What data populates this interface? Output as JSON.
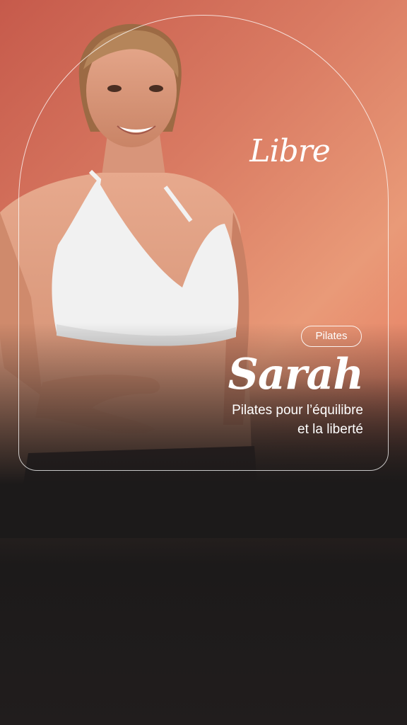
{
  "brand": {
    "word": "Libre"
  },
  "card": {
    "tag": "Pilates",
    "coach_name": "Sarah",
    "title_line1": "Pilates pour l’équilibre",
    "title_line2": "et la liberté"
  },
  "colors": {
    "bg_top": "#e99a78",
    "bg_accent": "#d85a48",
    "bg_bottom": "#1c1a1a",
    "text": "#ffffff"
  }
}
